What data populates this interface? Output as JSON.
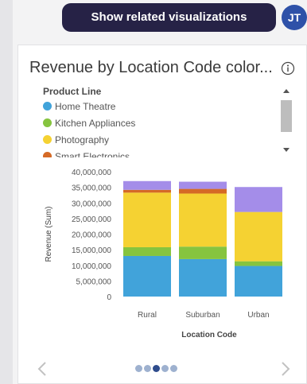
{
  "header": {
    "related_button_label": "Show related visualizations",
    "avatar_initials": "JT"
  },
  "card": {
    "title": "Revenue by Location Code color..."
  },
  "legend": {
    "title": "Product Line",
    "items": [
      {
        "label": "Home Theatre",
        "color": "#41a3da"
      },
      {
        "label": "Kitchen Appliances",
        "color": "#86c43f"
      },
      {
        "label": "Photography",
        "color": "#f5d232"
      },
      {
        "label": "Smart Electronics",
        "color": "#d56a26"
      }
    ]
  },
  "chart_data": {
    "type": "bar",
    "stacked": true,
    "categories": [
      "Rural",
      "Suburban",
      "Urban"
    ],
    "series": [
      {
        "name": "Home Theatre",
        "color": "#41a3da",
        "values": [
          13000000,
          12000000,
          9800000
        ]
      },
      {
        "name": "Kitchen Appliances",
        "color": "#86c43f",
        "values": [
          2800000,
          4000000,
          1500000
        ]
      },
      {
        "name": "Photography",
        "color": "#f5d232",
        "values": [
          17500000,
          17000000,
          15800000
        ]
      },
      {
        "name": "Smart Electronics",
        "color": "#d56a26",
        "values": [
          900000,
          1500000,
          0
        ]
      },
      {
        "name": "",
        "color": "#a48de9",
        "values": [
          2800000,
          2300000,
          8000000
        ]
      }
    ],
    "xlabel": "Location Code",
    "ylabel": "Revenue (Sum)",
    "ylim": [
      0,
      40000000
    ],
    "yticks": [
      "0",
      "5,000,000",
      "10,000,000",
      "15,000,000",
      "20,000,000",
      "25,000,000",
      "30,000,000",
      "35,000,000",
      "40,000,000"
    ],
    "grid": false
  },
  "pagination": {
    "page_count": 5,
    "active_index": 2
  }
}
